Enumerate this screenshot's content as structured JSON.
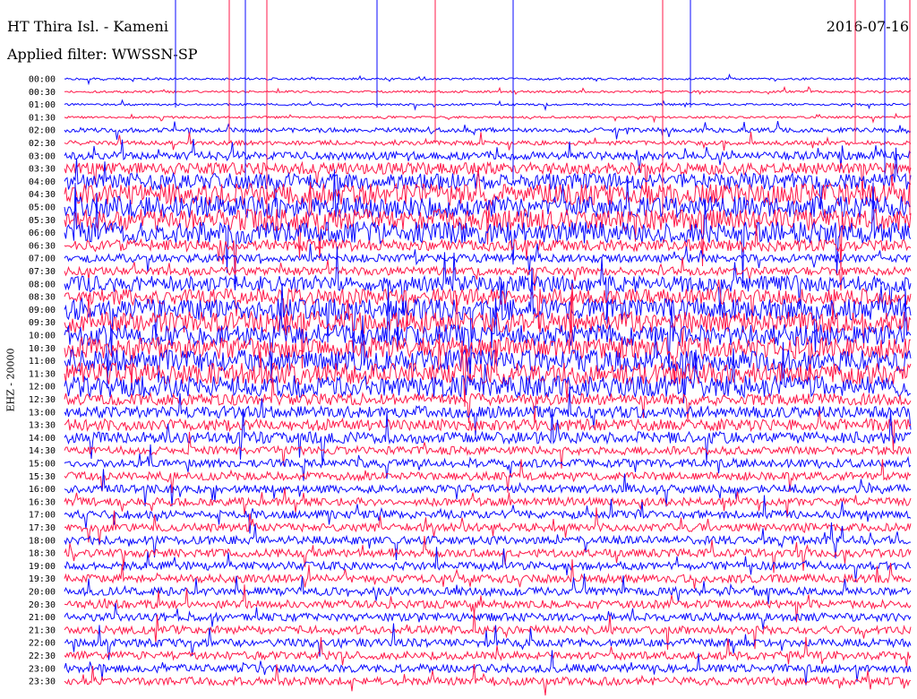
{
  "header": {
    "station": "HT Thira Isl. - Kameni",
    "date": "2016-07-16",
    "filter": "Applied filter: WWSSN-SP"
  },
  "channel_label": "EHZ - 20000",
  "colors": {
    "a": "#0a0aff",
    "b": "#ff1a4a"
  },
  "chart_data": {
    "type": "line",
    "title": "HT Thira Isl. - Kameni",
    "subtitle": "Applied filter: WWSSN-SP",
    "ylabel": "EHZ - 20000",
    "tick_labels": [
      "00:00",
      "00:30",
      "01:00",
      "01:30",
      "02:00",
      "02:30",
      "03:00",
      "03:30",
      "04:00",
      "04:30",
      "05:00",
      "05:30",
      "06:00",
      "06:30",
      "07:00",
      "07:30",
      "08:00",
      "08:30",
      "09:00",
      "09:30",
      "10:00",
      "10:30",
      "11:00",
      "11:30",
      "12:00",
      "12:30",
      "13:00",
      "13:30",
      "14:00",
      "14:30",
      "15:00",
      "15:30",
      "16:00",
      "16:30",
      "17:00",
      "17:30",
      "18:00",
      "18:30",
      "19:00",
      "19:30",
      "20:00",
      "20:30",
      "21:00",
      "21:30",
      "22:00",
      "22:30",
      "23:00",
      "23:30"
    ],
    "series_colors_alternate": [
      "#0a0aff",
      "#ff1a4a"
    ],
    "trace_amplitude_level": [
      1,
      1,
      1,
      1,
      2,
      2,
      3,
      4,
      5,
      6,
      6,
      6,
      6,
      4,
      3,
      3,
      5,
      5,
      6,
      6,
      6,
      6,
      6,
      6,
      6,
      4,
      4,
      4,
      4,
      3,
      3,
      3,
      3,
      3,
      3,
      3,
      3,
      3,
      3,
      3,
      3,
      3,
      3,
      3,
      3,
      3,
      3,
      3
    ]
  }
}
